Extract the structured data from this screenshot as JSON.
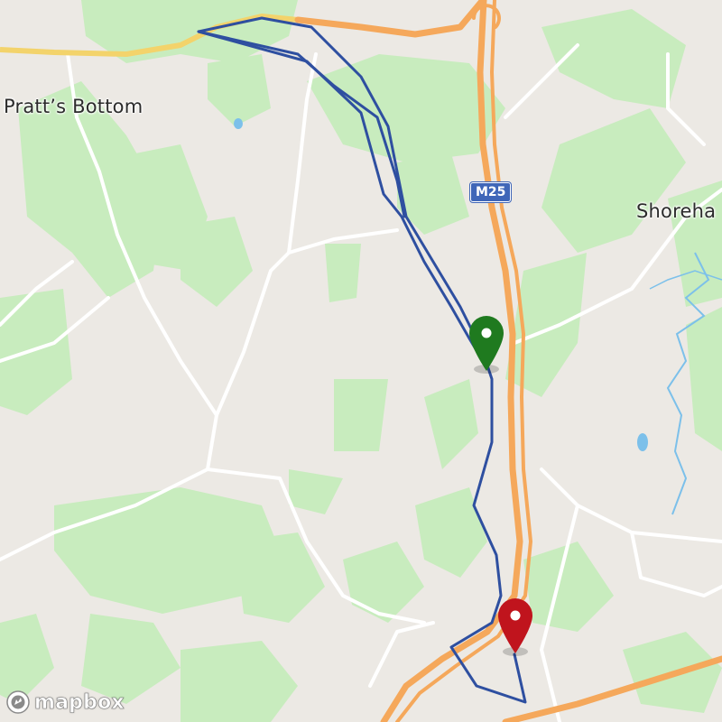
{
  "map": {
    "places": [
      {
        "name": "Pratt’s Bottom"
      },
      {
        "name": "Shoreha"
      }
    ],
    "road_shield": "M25",
    "attribution": "mapbox",
    "markers": {
      "start": {
        "type": "start",
        "color": "#1f7a1f"
      },
      "end": {
        "type": "end",
        "color": "#c0141d"
      }
    },
    "route_color": "#2e4fa0",
    "colors": {
      "background": "#ece9e4",
      "woodland": "#c8ecbe",
      "motorway": "#f5a85b",
      "primary_road": "#f3d36b",
      "minor_road": "#ffffff",
      "water": "#7cc0ea"
    }
  }
}
